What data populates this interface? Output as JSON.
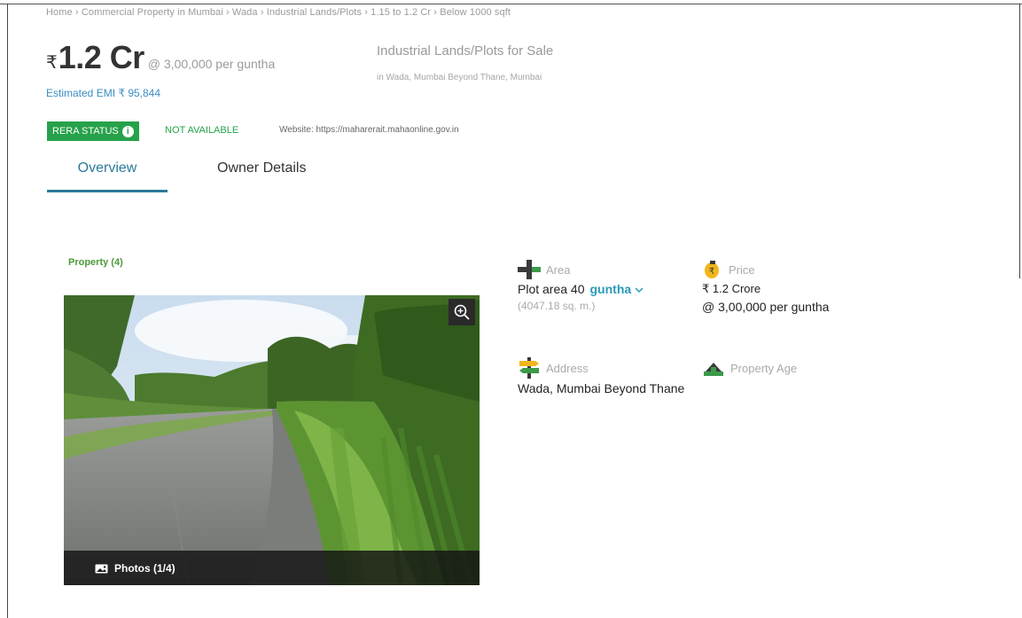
{
  "breadcrumb": "Home › Commercial Property in Mumbai › Wada › Industrial Lands/Plots › 1.15 to 1.2 Cr › Below 1000 sqft",
  "price": {
    "currency_symbol": "₹",
    "value": "1.2 Cr",
    "rate": "@ 3,00,000 per guntha",
    "emi": "Estimated EMI ₹ 95,844"
  },
  "property": {
    "title": "Industrial Lands/Plots for Sale",
    "location": "in Wada,  Mumbai Beyond Thane, Mumbai"
  },
  "rera": {
    "badge_label": "RERA STATUS",
    "info_icon": "i",
    "status": "NOT AVAILABLE",
    "website": "Website: https://maharerait.mahaonline.gov.in"
  },
  "tabs": [
    "Overview",
    "Owner Details"
  ],
  "section_title": "Property (4)",
  "photo": {
    "caption": "Photos (1/4)"
  },
  "details": {
    "area": {
      "label": "Area",
      "value": "Plot area 40",
      "unit": "guntha",
      "sub": "(4047.18 sq. m.)"
    },
    "price": {
      "label": "Price",
      "value": "₹ 1.2 Crore",
      "sub": "@ 3,00,000 per guntha"
    },
    "address": {
      "label": "Address",
      "value": "Wada, Mumbai Beyond Thane"
    },
    "age": {
      "label": "Property Age"
    }
  },
  "colors": {
    "rera_green": "#26a24a",
    "tab_accent": "#2a7a9a",
    "link_blue": "#3a8ec2",
    "unit_blue": "#2a9ab6"
  },
  "icons": [
    "info-icon",
    "zoom-in-icon",
    "camera-icon",
    "area-icon",
    "price-icon",
    "address-icon",
    "property-age-icon",
    "chevron-down-icon"
  ]
}
